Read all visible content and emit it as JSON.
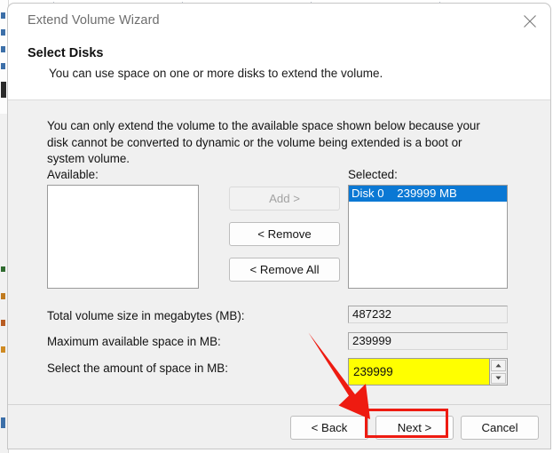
{
  "window": {
    "title": "Extend Volume Wizard",
    "close_icon": "close-icon"
  },
  "header": {
    "title": "Select Disks",
    "subtitle": "You can use space on one or more disks to extend the volume."
  },
  "body": {
    "intro": "You can only extend the volume to the available space shown below because your disk cannot be converted to dynamic or the volume being extended is a boot or system volume.",
    "available_label": "Available:",
    "selected_label": "Selected:",
    "available_items": [],
    "selected_items": [
      {
        "disk": "Disk 0",
        "size": "239999 MB",
        "text": "Disk 0    239999 MB",
        "selected": true
      }
    ],
    "transfer_buttons": [
      {
        "label": "Add >",
        "enabled": false
      },
      {
        "label": "< Remove",
        "enabled": true
      },
      {
        "label": "< Remove All",
        "enabled": true
      }
    ],
    "fields": [
      {
        "label": "Total volume size in megabytes (MB):",
        "value": "487232",
        "editable": false
      },
      {
        "label": "Maximum available space in MB:",
        "value": "239999",
        "editable": false
      },
      {
        "label": "Select the amount of space in MB:",
        "value": "239999",
        "editable": true,
        "highlight_color": "#ffff00"
      }
    ],
    "spinner": {
      "up_icon": "spinner-up-icon",
      "down_icon": "spinner-down-icon"
    }
  },
  "footer": {
    "back_label": "< Back",
    "next_label": "Next >",
    "cancel_label": "Cancel"
  },
  "annotations": {
    "arrow_color": "#ee1b11",
    "highlight_color": "#ee1b11",
    "highlight_target": "Next >"
  },
  "colors": {
    "selection_blue": "#0a78d4",
    "dialog_background": "#f0f0f0",
    "title_text": "#6e6e6e"
  }
}
